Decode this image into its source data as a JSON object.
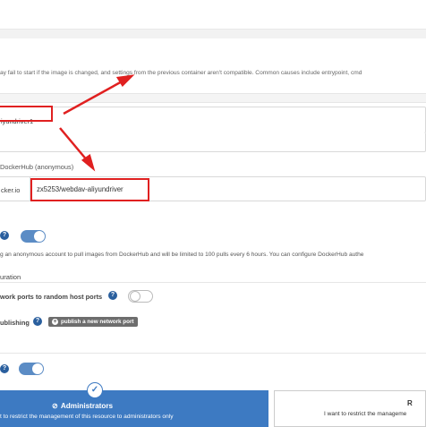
{
  "warning_text": "ay fail to start if the image is changed, and settings from the previous container aren't compatible. Common causes include entrypoint, cmd",
  "name_field": {
    "value": "iyundriver1"
  },
  "registry": {
    "label": "DockerHub (anonymous)",
    "prefix": "cker.io",
    "image_value": "zx5253/webdav-aliyundriver"
  },
  "anonymous_note": "g an anonymous account to pull images from DockerHub and will be limited to 100 pulls every 6 hours. You can configure DockerHub authe",
  "section_title": "uration",
  "publish_ports": {
    "label": "work ports to random host ports"
  },
  "manual_publishing": {
    "label": "ublishing",
    "button_label": "publish a new network port",
    "plus": "+"
  },
  "access_cards": {
    "admin": {
      "title": "Administrators",
      "description": "t to restrict the management of this resource to administrators only",
      "check": "✓",
      "icon": "⊘"
    },
    "restricted": {
      "title": "R",
      "description": "I want to restrict the manageme"
    }
  },
  "help_icon": "?",
  "accent_colors": {
    "highlight": "#e02020",
    "toggle_on": "#5b8cc5",
    "selected_card": "#3d7ac2"
  }
}
